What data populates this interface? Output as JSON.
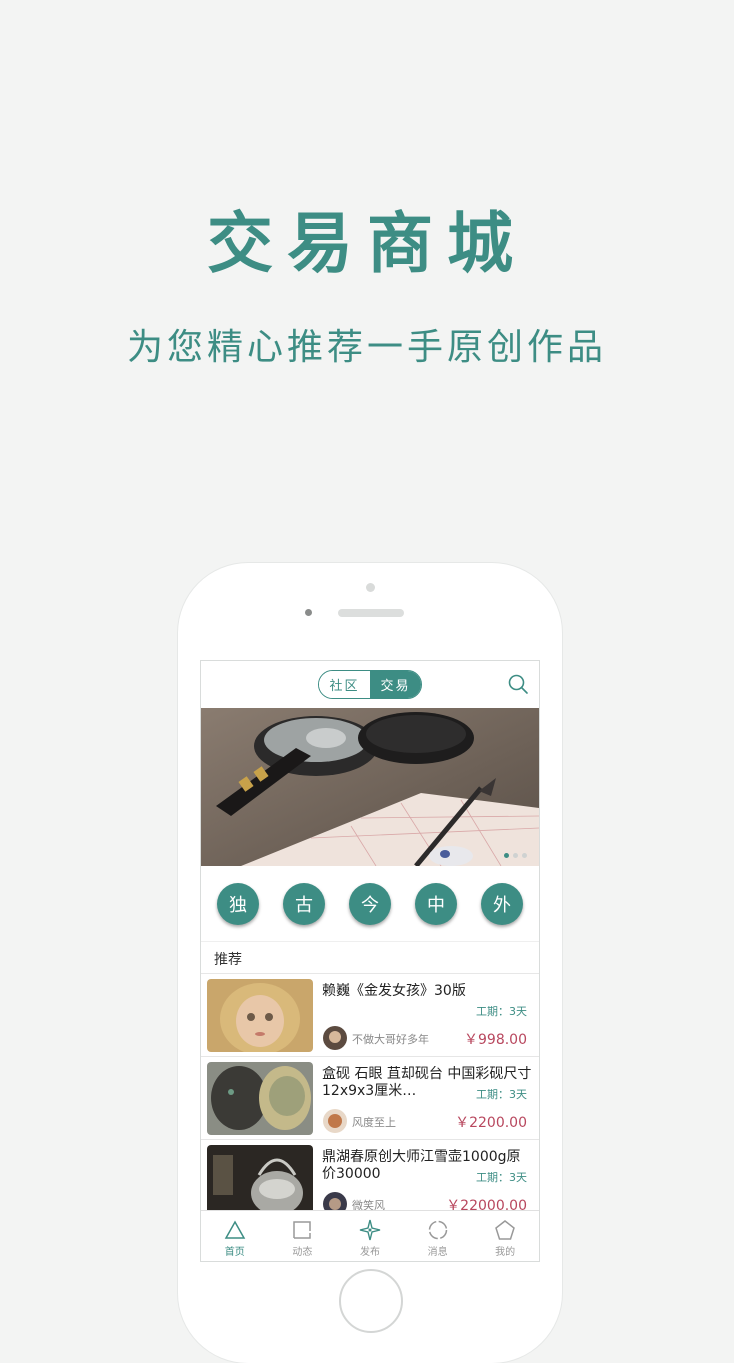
{
  "hero": {
    "title": "交易商城",
    "subtitle": "为您精心推荐一手原创作品"
  },
  "app": {
    "segments": [
      {
        "label": "社区",
        "active": false
      },
      {
        "label": "交易",
        "active": true
      }
    ],
    "search_icon": "search-icon",
    "banner": {
      "image": "calligraphy ink stick, ink stone and brush on grid paper",
      "page_count": 3,
      "active_page": 1
    },
    "categories": [
      "独",
      "古",
      "今",
      "中",
      "外"
    ],
    "section_title": "推荐",
    "items": [
      {
        "title": "赖巍《金发女孩》30版",
        "period": "工期：3天",
        "seller": "不做大哥好多年",
        "price": "￥998.00"
      },
      {
        "title": "盒砚 石眼 苴却砚台 中国彩砚尺寸12x9x3厘米…",
        "period": "工期：3天",
        "seller": "风度至上",
        "price": "￥2200.00"
      },
      {
        "title": "鼎湖春原创大师江雪壶1000g原价30000",
        "period": "工期：3天",
        "seller": "微笑风",
        "price": "￥22000.00"
      }
    ],
    "tabs": [
      {
        "label": "首页",
        "icon": "triangle-icon",
        "active": true
      },
      {
        "label": "动态",
        "icon": "square-icon",
        "active": false
      },
      {
        "label": "发布",
        "icon": "compass-star-icon",
        "active": false
      },
      {
        "label": "消息",
        "icon": "circle-icon",
        "active": false
      },
      {
        "label": "我的",
        "icon": "pentagon-icon",
        "active": false
      }
    ],
    "accent_color": "#3d8d84",
    "price_color": "#b8475e"
  }
}
